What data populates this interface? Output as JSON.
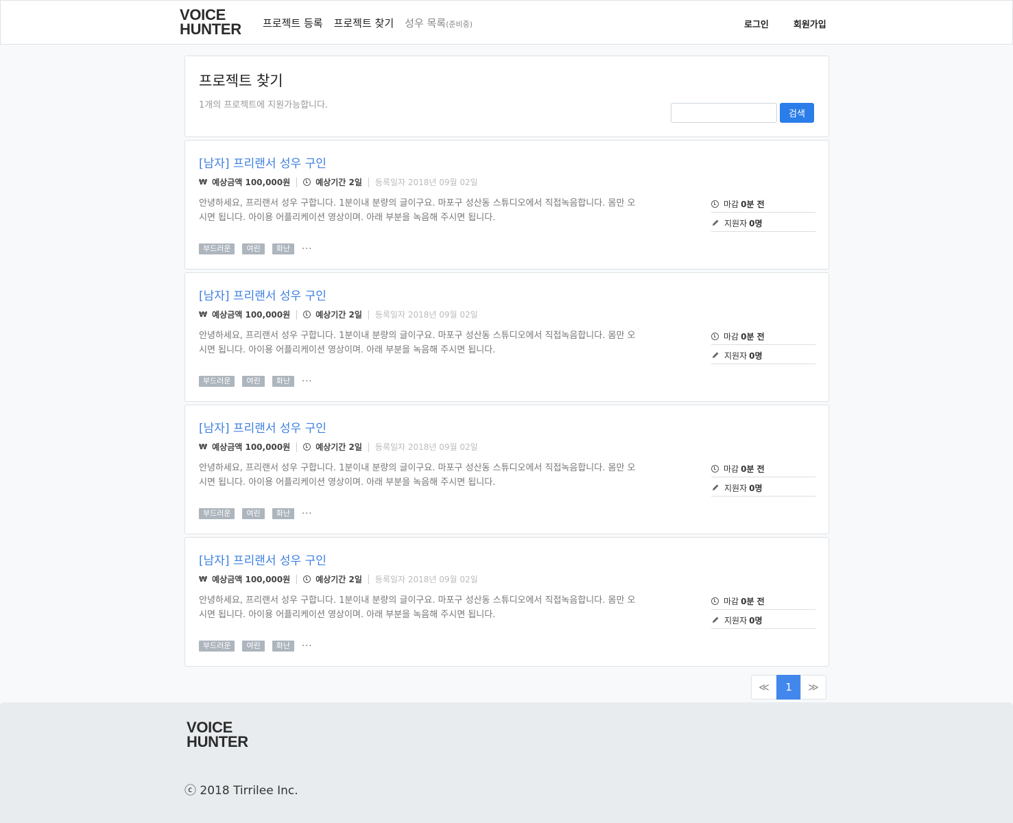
{
  "header": {
    "logo_line1": "VOICE",
    "logo_line2": "HUNTER",
    "nav": {
      "register": "프로젝트 등록",
      "find": "프로젝트 찾기",
      "actors": "성우 목록",
      "actors_sub": "(준비중)"
    },
    "login": "로그인",
    "signup": "회원가입"
  },
  "search_panel": {
    "title": "프로젝트 찾기",
    "subtitle": "1개의 프로젝트에 지원가능합니다.",
    "input_placeholder": "",
    "button": "검색"
  },
  "projects": [
    {
      "title": "[남자] 프리랜서 성우 구인",
      "price_symbol": "₩",
      "price": "예상금액 100,000원",
      "duration": "예상기간 2일",
      "date": "등록일자 2018년 09월 02일",
      "description": "안녕하세요, 프리랜서 성우 구합니다. 1분이내 분량의 글이구요. 마포구 성산동 스튜디오에서 직접녹음합니다. 몸만 오시면 됩니다. 아이용 어플리케이션 영상이며. 아래 부분을 녹음해 주시면 됩니다.",
      "tags": [
        "부드러운",
        "여린",
        "화난"
      ],
      "more": "···",
      "deadline_label": "마감",
      "deadline_value": "0분 전",
      "applicants_label": "지원자",
      "applicants_value": "0명"
    },
    {
      "title": "[남자] 프리랜서 성우 구인",
      "price_symbol": "₩",
      "price": "예상금액 100,000원",
      "duration": "예상기간 2일",
      "date": "등록일자 2018년 09월 02일",
      "description": "안녕하세요, 프리랜서 성우 구합니다. 1분이내 분량의 글이구요. 마포구 성산동 스튜디오에서 직접녹음합니다. 몸만 오시면 됩니다. 아이용 어플리케이션 영상이며. 아래 부분을 녹음해 주시면 됩니다.",
      "tags": [
        "부드러운",
        "여린",
        "화난"
      ],
      "more": "···",
      "deadline_label": "마감",
      "deadline_value": "0분 전",
      "applicants_label": "지원자",
      "applicants_value": "0명"
    },
    {
      "title": "[남자] 프리랜서 성우 구인",
      "price_symbol": "₩",
      "price": "예상금액 100,000원",
      "duration": "예상기간 2일",
      "date": "등록일자 2018년 09월 02일",
      "description": "안녕하세요, 프리랜서 성우 구합니다. 1분이내 분량의 글이구요. 마포구 성산동 스튜디오에서 직접녹음합니다. 몸만 오시면 됩니다. 아이용 어플리케이션 영상이며. 아래 부분을 녹음해 주시면 됩니다.",
      "tags": [
        "부드러운",
        "여린",
        "화난"
      ],
      "more": "···",
      "deadline_label": "마감",
      "deadline_value": "0분 전",
      "applicants_label": "지원자",
      "applicants_value": "0명"
    },
    {
      "title": "[남자] 프리랜서 성우 구인",
      "price_symbol": "₩",
      "price": "예상금액 100,000원",
      "duration": "예상기간 2일",
      "date": "등록일자 2018년 09월 02일",
      "description": "안녕하세요, 프리랜서 성우 구합니다. 1분이내 분량의 글이구요. 마포구 성산동 스튜디오에서 직접녹음합니다. 몸만 오시면 됩니다. 아이용 어플리케이션 영상이며. 아래 부분을 녹음해 주시면 됩니다.",
      "tags": [
        "부드러운",
        "여린",
        "화난"
      ],
      "more": "···",
      "deadline_label": "마감",
      "deadline_value": "0분 전",
      "applicants_label": "지원자",
      "applicants_value": "0명"
    }
  ],
  "pagination": {
    "prev": "≪",
    "current": "1",
    "next": "≫"
  },
  "footer": {
    "logo_line1": "VOICE",
    "logo_line2": "HUNTER",
    "copyright": "ⓒ 2018 Tirrilee Inc."
  },
  "colors": {
    "accent": "#2b7de9",
    "title_link": "#3d7fe0",
    "tag_bg": "#adb5bd",
    "footer_bg": "#e9ecef"
  }
}
